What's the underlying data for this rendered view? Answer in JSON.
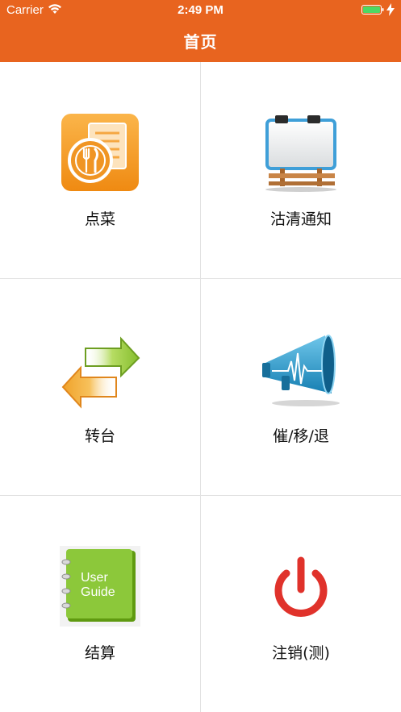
{
  "status_bar": {
    "carrier": "Carrier",
    "time": "2:49 PM",
    "wifi_icon": "wifi-icon",
    "battery_icon": "battery-icon",
    "charging_icon": "charging-bolt-icon"
  },
  "nav": {
    "title": "首页",
    "color": "#e8641f"
  },
  "menu": {
    "items": [
      {
        "label": "点菜",
        "icon": "dining-menu-icon"
      },
      {
        "label": "沽清通知",
        "icon": "notice-board-icon"
      },
      {
        "label": "转台",
        "icon": "transfer-arrows-icon"
      },
      {
        "label": "催/移/退",
        "icon": "megaphone-icon"
      },
      {
        "label": "结算",
        "icon": "user-guide-book-icon",
        "icon_text_1": "User",
        "icon_text_2": "Guide"
      },
      {
        "label": "注销(测)",
        "icon": "power-icon"
      }
    ]
  }
}
